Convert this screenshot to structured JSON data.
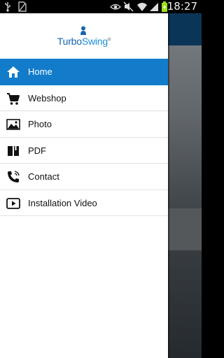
{
  "status_bar": {
    "time": "18:27",
    "icons": [
      "usb-icon",
      "no-sim-icon",
      "eye-icon",
      "mute-icon",
      "wifi-icon",
      "signal-icon",
      "battery-charging-icon"
    ]
  },
  "drawer": {
    "logo": {
      "part1": "Turbo",
      "part2": "Swing",
      "reg": "®"
    },
    "items": [
      {
        "label": "Home",
        "icon": "home-icon",
        "active": true
      },
      {
        "label": "Webshop",
        "icon": "cart-icon"
      },
      {
        "label": "Photo",
        "icon": "image-icon"
      },
      {
        "label": "PDF",
        "icon": "book-icon"
      },
      {
        "label": "Contact",
        "icon": "phone-icon"
      },
      {
        "label": "Installation Video",
        "icon": "play-icon"
      }
    ]
  },
  "colors": {
    "accent": "#127ccb",
    "logo_dark": "#1565b0",
    "logo_light": "#1a8fd6",
    "app_bar": "#0b3557"
  }
}
